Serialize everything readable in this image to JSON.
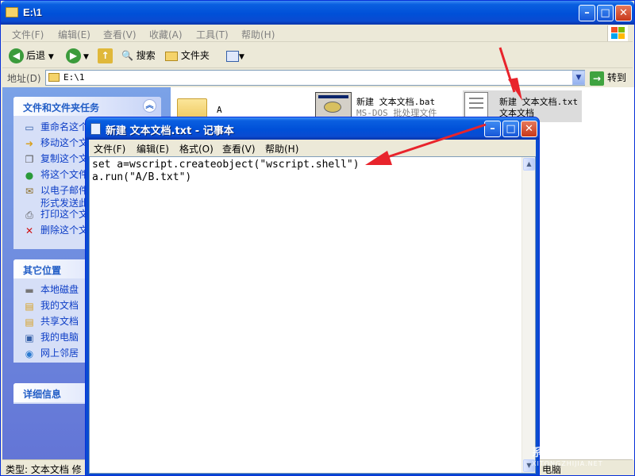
{
  "explorer": {
    "title": "E:\\1",
    "menu": [
      "文件(F)",
      "编辑(E)",
      "查看(V)",
      "收藏(A)",
      "工具(T)",
      "帮助(H)"
    ],
    "toolbar": {
      "back": "后退",
      "search": "搜索",
      "folders": "文件夹"
    },
    "address": {
      "label": "地址(D)",
      "path": "E:\\1",
      "go": "转到"
    },
    "tasks_panel": {
      "title": "文件和文件夹任务",
      "items": [
        "重命名这个文件",
        "移动这个文件",
        "复制这个文件",
        "将这个文件发布到 Web",
        "以电子邮件形式发送此文件",
        "打印这个文件",
        "删除这个文件"
      ]
    },
    "places_panel": {
      "title": "其它位置",
      "items": [
        "本地磁盘",
        "我的文档",
        "共享文档",
        "我的电脑",
        "网上邻居"
      ]
    },
    "details_panel": {
      "title": "详细信息"
    },
    "files": [
      {
        "name": "A",
        "type": ""
      },
      {
        "name": "新建 文本文档.bat",
        "type": "MS-DOS 批处理文件"
      },
      {
        "name": "新建 文本文档.txt",
        "type": "文本文档"
      }
    ],
    "status": {
      "left": "类型: 文本文档 修",
      "right": "电脑"
    }
  },
  "notepad": {
    "title": "新建 文本文档.txt - 记事本",
    "menu": [
      "文件(F)",
      "编辑(E)",
      "格式(O)",
      "查看(V)",
      "帮助(H)"
    ],
    "content_lines": [
      "set a=wscript.createobject(\"wscript.shell\")",
      "a.run(\"A/B.txt\")"
    ]
  },
  "colors": {
    "annotation_arrow": "#e8242c",
    "xp_title": "#0a5fe0",
    "task_link": "#0c3dc6"
  },
  "watermark": {
    "text": "系统之家",
    "url": "XITONGZHIJIA.NET"
  }
}
